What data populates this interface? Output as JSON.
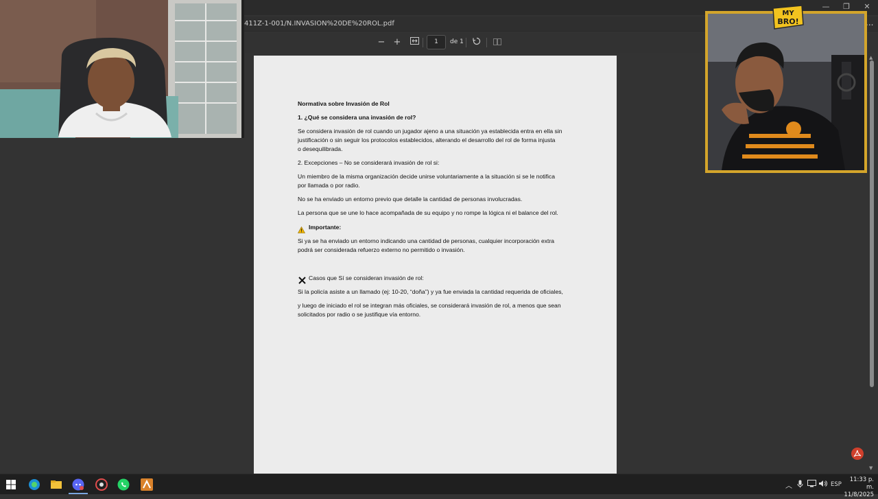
{
  "browser": {
    "url": "411Z-1-001/N.INVASION%20DE%20ROL.pdf",
    "more_label": "...",
    "window_controls": {
      "minimize": "—",
      "restore": "❐",
      "close": "✕"
    }
  },
  "viewer": {
    "zoom_out": "−",
    "zoom_in": "+",
    "current_page": "1",
    "page_of": "de 1"
  },
  "document": {
    "title": "Normativa sobre Invasión de Rol",
    "section1_heading": "1. ¿Qué se considera una invasión de rol?",
    "section1_body_1": " Se considera invasión de rol cuando un jugador ajeno a una situación ya establecida entra en ella sin",
    "section1_body_2": "justificación o sin seguir los protocolos establecidos, alterando el desarrollo del rol de forma injusta",
    "section1_body_3": "o desequilibrada.",
    "section2_heading": "2. Excepciones – No se considerará invasión de rol si:",
    "exception1_a": "Un miembro de la misma organización decide unirse voluntariamente a la situación  si se le notifica",
    "exception1_b": "por llamada o por radio.",
    "exception2": "No se ha enviado un entorno previo que detalle la cantidad de personas involucradas.",
    "exception3": "La persona que se une lo hace acompañada de su equipo y no rompe la lógica ni el balance del rol.",
    "important_label": "Importante:",
    "important_body_1": " Si ya se ha enviado un entorno indicando una cantidad de personas, cualquier incorporación extra",
    "important_body_2": "podrá ser considerada refuerzo externo no permitido o invasión.",
    "cases_heading": "Casos que Sí se consideran invasión de rol:",
    "case1": "Si la policía asiste a un llamado (ej: 10-20, “doña”) y ya fue enviada la cantidad requerida de oficiales,",
    "case1_cont_1": " y luego de iniciado el rol se integran más oficiales, se considerará invasión de rol, a menos que sean",
    "case1_cont_2": "solicitados por radio o se justifique vía entorno."
  },
  "overlay": {
    "badge_line1": "MY",
    "badge_line2": "BRO!"
  },
  "taskbar": {
    "language": "ESP",
    "time": "11:33 p. m.",
    "date": "11/8/2025"
  },
  "colors": {
    "frame_gold": "#d4a52b",
    "pdf_red": "#d0402c",
    "page_bg": "#ececec"
  }
}
